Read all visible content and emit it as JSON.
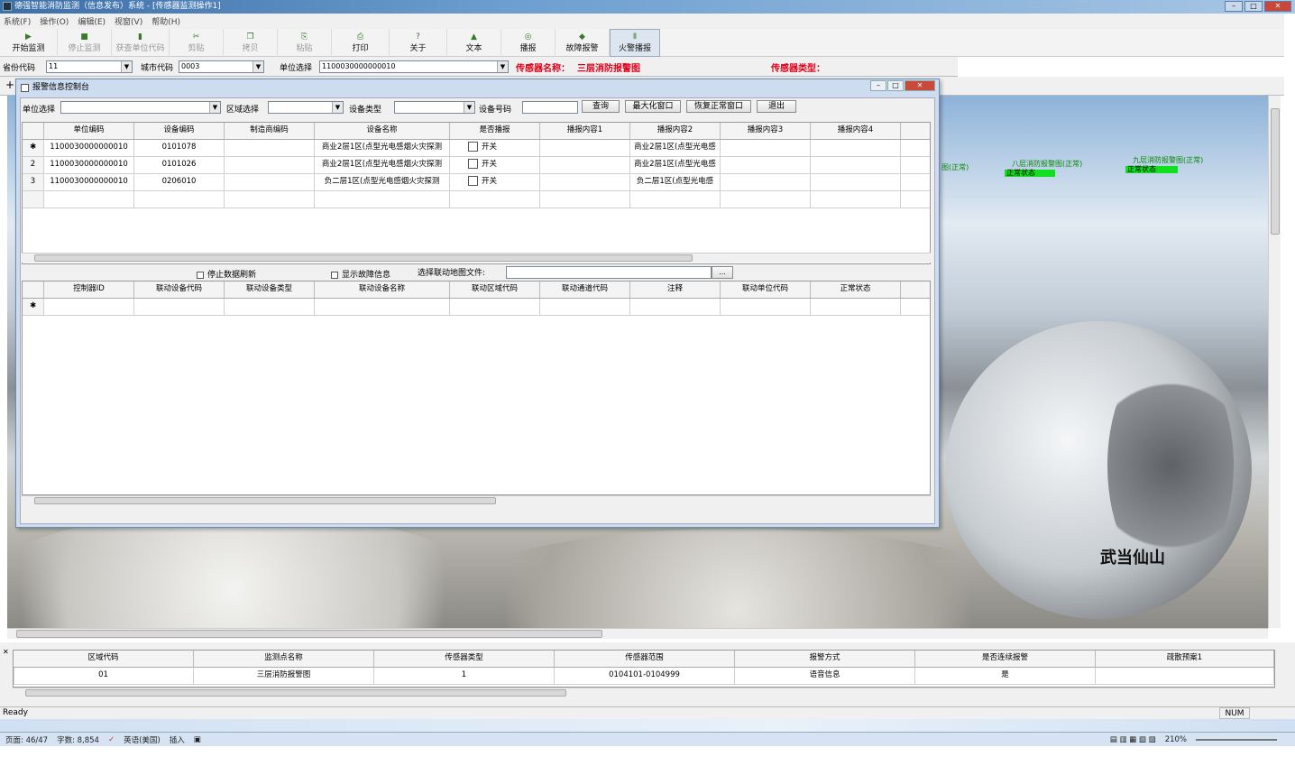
{
  "window": {
    "title": "德强智能消防监测（信息发布）系统 - [传感器监测操作1]"
  },
  "menu": [
    "系统(F)",
    "操作(O)",
    "编辑(E)",
    "视窗(V)",
    "帮助(H)"
  ],
  "toolbar": [
    {
      "label": "开始监测",
      "icon": "▶",
      "disabled": false,
      "w": 64
    },
    {
      "label": "停止监测",
      "icon": "■",
      "disabled": true,
      "w": 60
    },
    {
      "label": "获查单位代码",
      "icon": "▮",
      "disabled": true,
      "w": 64
    },
    {
      "label": "剪贴",
      "icon": "✂",
      "disabled": true,
      "w": 60
    },
    {
      "label": "拷贝",
      "icon": "❐",
      "disabled": true,
      "w": 60
    },
    {
      "label": "粘贴",
      "icon": "⎘",
      "disabled": true,
      "w": 60
    },
    {
      "label": "打印",
      "icon": "⎙",
      "disabled": false,
      "w": 64
    },
    {
      "label": "关于",
      "icon": "?",
      "disabled": false,
      "w": 64
    },
    {
      "label": "文本",
      "icon": "▲",
      "disabled": false,
      "w": 60
    },
    {
      "label": "播报",
      "icon": "◎",
      "disabled": false,
      "w": 60
    },
    {
      "label": "故障报警",
      "icon": "◆",
      "disabled": false,
      "w": 60
    },
    {
      "label": "火警播报",
      "icon": "Ⅱ",
      "disabled": false,
      "w": 56
    }
  ],
  "params": {
    "province_label": "省份代码",
    "province_value": "11",
    "city_label": "城市代码",
    "city_value": "0003",
    "unit_label": "单位选择",
    "unit_value": "1100030000000010",
    "sensor_name_label": "传感器名称：",
    "sensor_name_value": "三层消防报警图",
    "sensor_type_label": "传感器类型："
  },
  "map_labels": [
    {
      "text": "图(正常)"
    },
    {
      "text": "八层消防报警图(正常)"
    },
    {
      "text": "正常状态"
    },
    {
      "text": "九层消防报警图(正常)"
    },
    {
      "text": "正常状态"
    }
  ],
  "calligraphy": "武当仙山",
  "dialog": {
    "title": "报警信息控制台",
    "filters": {
      "unit_label": "单位选择",
      "area_label": "区域选择",
      "type_label": "设备类型",
      "code_label": "设备号码"
    },
    "buttons": [
      "查询",
      "最大化窗口",
      "恢复正常窗口",
      "退出"
    ],
    "grid1": {
      "headers": [
        "单位编码",
        "设备编码",
        "制造商编码",
        "设备名称",
        "是否播报",
        "播报内容1",
        "播报内容2",
        "播报内容3",
        "播报内容4"
      ],
      "rows": [
        {
          "marker": "✱",
          "unit": "1100030000000010",
          "device": "0101078",
          "maker": "",
          "name": "商业2层1区(点型光电感烟火灾探测",
          "broadcast": "开关",
          "c1": "",
          "c2": "商业2层1区(点型光电感",
          "c3": "",
          "c4": ""
        },
        {
          "marker": "2",
          "unit": "1100030000000010",
          "device": "0101026",
          "maker": "",
          "name": "商业2层1区(点型光电感烟火灾探测",
          "broadcast": "开关",
          "c1": "",
          "c2": "商业2层1区(点型光电感",
          "c3": "",
          "c4": ""
        },
        {
          "marker": "3",
          "unit": "1100030000000010",
          "device": "0206010",
          "maker": "",
          "name": "负二层1区(点型光电感烟火灾探测",
          "broadcast": "开关",
          "c1": "",
          "c2": "负二层1区(点型光电感",
          "c3": "",
          "c4": ""
        }
      ]
    },
    "options": {
      "stop_refresh": "停止数据刷新",
      "show_fault": "显示故障信息",
      "map_file_label": "选择联动地图文件:",
      "browse": "..."
    },
    "grid2": {
      "headers": [
        "控制器ID",
        "联动设备代码",
        "联动设备类型",
        "联动设备名称",
        "联动区域代码",
        "联动通道代码",
        "注释",
        "联动单位代码",
        "正常状态"
      ],
      "new_marker": "✱"
    }
  },
  "bottom_grid": {
    "headers": [
      "区域代码",
      "监测点名称",
      "传感器类型",
      "传感器范围",
      "报警方式",
      "是否连续报警",
      "疏散预案1"
    ],
    "rows": [
      [
        "01",
        "三层消防报警图",
        "1",
        "0104101-0104999",
        "语音信息",
        "是",
        ""
      ]
    ]
  },
  "status": {
    "ready": "Ready",
    "num": "NUM"
  },
  "word_status": {
    "page": "页面: 46/47",
    "words": "字数: 8,854",
    "lang": "英语(美国)",
    "insert": "插入",
    "zoom": "210%"
  }
}
